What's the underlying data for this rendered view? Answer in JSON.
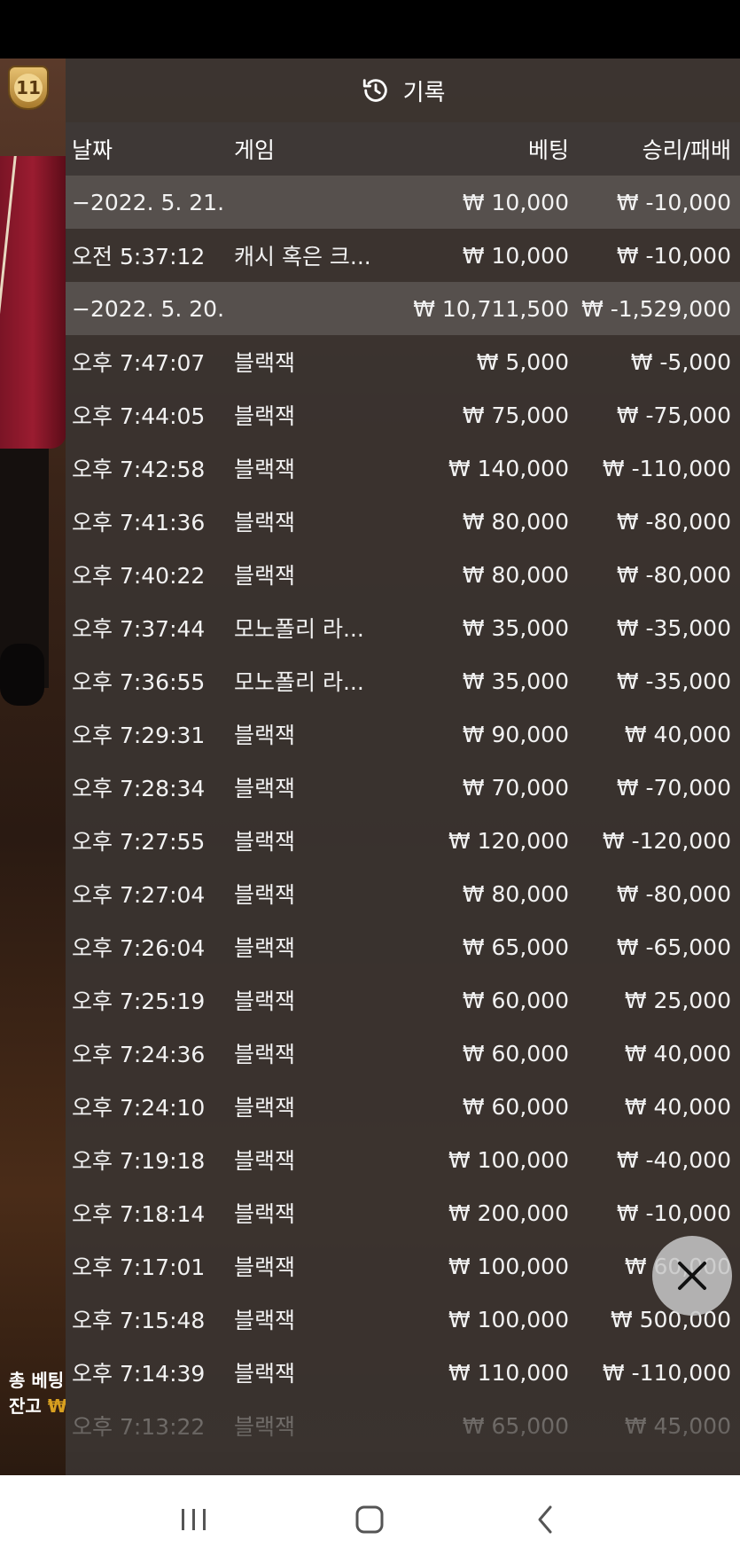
{
  "panel": {
    "title": "기록"
  },
  "player": {
    "rank": "11"
  },
  "side_info": {
    "total_bet_label": "총 베팅",
    "balance_label": "잔고",
    "currency_symbol": "₩"
  },
  "columns": {
    "date": "날짜",
    "game": "게임",
    "bet": "베팅",
    "win_loss": "승리/패배"
  },
  "rows": [
    {
      "type": "group",
      "date": "−2022. 5. 21.",
      "bet": "₩ 10,000",
      "win": "₩ -10,000"
    },
    {
      "type": "item",
      "time": "오전 5:37:12",
      "game": "캐시 혹은 크...",
      "bet": "₩ 10,000",
      "win": "₩ -10,000"
    },
    {
      "type": "group",
      "date": "−2022. 5. 20.",
      "bet": "₩ 10,711,500",
      "win": "₩ -1,529,000"
    },
    {
      "type": "item",
      "time": "오후 7:47:07",
      "game": "블랙잭",
      "bet": "₩ 5,000",
      "win": "₩ -5,000"
    },
    {
      "type": "item",
      "time": "오후 7:44:05",
      "game": "블랙잭",
      "bet": "₩ 75,000",
      "win": "₩ -75,000"
    },
    {
      "type": "item",
      "time": "오후 7:42:58",
      "game": "블랙잭",
      "bet": "₩ 140,000",
      "win": "₩ -110,000"
    },
    {
      "type": "item",
      "time": "오후 7:41:36",
      "game": "블랙잭",
      "bet": "₩ 80,000",
      "win": "₩ -80,000"
    },
    {
      "type": "item",
      "time": "오후 7:40:22",
      "game": "블랙잭",
      "bet": "₩ 80,000",
      "win": "₩ -80,000"
    },
    {
      "type": "item",
      "time": "오후 7:37:44",
      "game": "모노폴리 라...",
      "bet": "₩ 35,000",
      "win": "₩ -35,000"
    },
    {
      "type": "item",
      "time": "오후 7:36:55",
      "game": "모노폴리 라...",
      "bet": "₩ 35,000",
      "win": "₩ -35,000"
    },
    {
      "type": "item",
      "time": "오후 7:29:31",
      "game": "블랙잭",
      "bet": "₩ 90,000",
      "win": "₩ 40,000"
    },
    {
      "type": "item",
      "time": "오후 7:28:34",
      "game": "블랙잭",
      "bet": "₩ 70,000",
      "win": "₩ -70,000"
    },
    {
      "type": "item",
      "time": "오후 7:27:55",
      "game": "블랙잭",
      "bet": "₩ 120,000",
      "win": "₩ -120,000"
    },
    {
      "type": "item",
      "time": "오후 7:27:04",
      "game": "블랙잭",
      "bet": "₩ 80,000",
      "win": "₩ -80,000"
    },
    {
      "type": "item",
      "time": "오후 7:26:04",
      "game": "블랙잭",
      "bet": "₩ 65,000",
      "win": "₩ -65,000"
    },
    {
      "type": "item",
      "time": "오후 7:25:19",
      "game": "블랙잭",
      "bet": "₩ 60,000",
      "win": "₩ 25,000"
    },
    {
      "type": "item",
      "time": "오후 7:24:36",
      "game": "블랙잭",
      "bet": "₩ 60,000",
      "win": "₩ 40,000"
    },
    {
      "type": "item",
      "time": "오후 7:24:10",
      "game": "블랙잭",
      "bet": "₩ 60,000",
      "win": "₩ 40,000"
    },
    {
      "type": "item",
      "time": "오후 7:19:18",
      "game": "블랙잭",
      "bet": "₩ 100,000",
      "win": "₩ -40,000"
    },
    {
      "type": "item",
      "time": "오후 7:18:14",
      "game": "블랙잭",
      "bet": "₩ 200,000",
      "win": "₩ -10,000"
    },
    {
      "type": "item",
      "time": "오후 7:17:01",
      "game": "블랙잭",
      "bet": "₩ 100,000",
      "win": "₩ 60,000"
    },
    {
      "type": "item",
      "time": "오후 7:15:48",
      "game": "블랙잭",
      "bet": "₩ 100,000",
      "win": "₩ 500,000"
    },
    {
      "type": "item",
      "time": "오후 7:14:39",
      "game": "블랙잭",
      "bet": "₩ 110,000",
      "win": "₩ -110,000"
    },
    {
      "type": "item",
      "time": "오후 7:13:22",
      "game": "블랙잭",
      "bet": "₩ 65,000",
      "win": "₩ 45,000",
      "dim": true
    }
  ],
  "nav": {
    "recents_icon": "recents-icon",
    "home_icon": "home-icon",
    "back_icon": "back-icon"
  },
  "colors": {
    "panel_bg": "#3a3430",
    "group_row_bg": "#56504d",
    "header_bg": "#3e3836",
    "balance_accent": "#d8a020"
  }
}
